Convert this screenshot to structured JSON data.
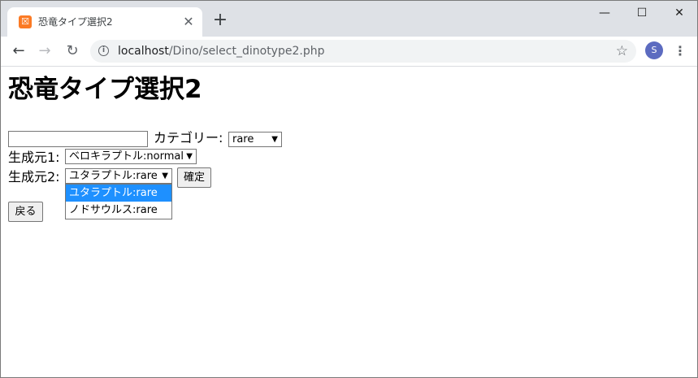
{
  "browser": {
    "tab_title": "恐竜タイプ選択2",
    "favicon_glyph": "☒",
    "url_host": "localhost",
    "url_path": "/Dino/select_dinotype2.php",
    "avatar_initial": "S",
    "colors": {
      "tabstrip": "#dee1e6",
      "omnibox": "#f1f3f4",
      "avatar": "#5c6bc0",
      "favicon": "#fb7a24"
    }
  },
  "icons": {
    "close_tab": "✕",
    "new_tab": "+",
    "minimize": "—",
    "maximize": "☐",
    "close_window": "✕",
    "back": "←",
    "forward": "→",
    "reload": "↻",
    "info": "i",
    "star": "☆",
    "menu": "⋮",
    "select_arrow": "▼"
  },
  "page": {
    "title": "恐竜タイプ選択2",
    "name_input_value": "",
    "category_label": "カテゴリー:",
    "category_value": "rare",
    "source1_label": "生成元1:",
    "source1_value": "ベロキラプトル:normal",
    "source2_label": "生成元2:",
    "source2_value": "ユタラプトル:rare",
    "confirm_button": "確定",
    "back_button": "戻る",
    "source2_options": [
      {
        "label": "ユタラプトル:rare",
        "selected": true
      },
      {
        "label": "ノドサウルス:rare",
        "selected": false
      }
    ],
    "highlight_color": "#1e90ff"
  }
}
